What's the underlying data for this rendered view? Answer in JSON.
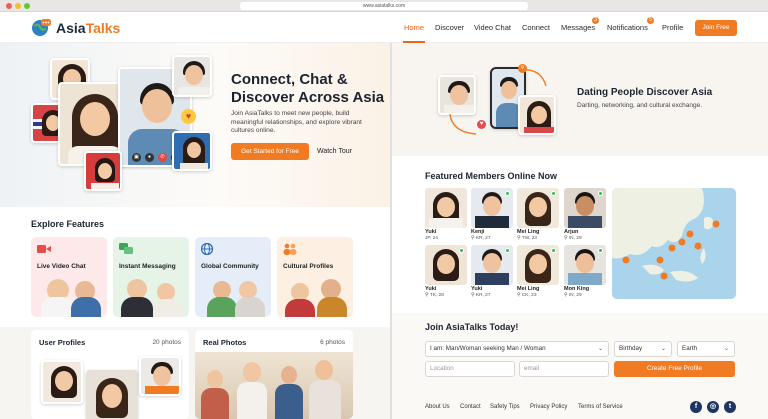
{
  "browser": {
    "url": "www.asiatalks.com"
  },
  "brand": {
    "name_part1": "Asia",
    "name_part2": "Talks",
    "accent": "#f07b22"
  },
  "nav": {
    "links": [
      "Home",
      "Discover",
      "Video Chat",
      "Connect",
      "Messages",
      "Notifications",
      "Profile"
    ],
    "active": "Home",
    "messages_badge": "3",
    "notifications_badge": "5",
    "join_label": "Join Free"
  },
  "hero": {
    "title": "Connect, Chat & Discover Across Asia",
    "subtitle": "Join AsiaTalks to meet new people, build meaningful relationships, and explore vibrant cultures online.",
    "cta_label": "Get Started for Free",
    "tour_label": "Watch Tour"
  },
  "explore": {
    "title": "Explore Features",
    "features": [
      {
        "label": "Live Video Chat",
        "icon": "video-camera-icon"
      },
      {
        "label": "Instant Messaging",
        "icon": "chat-bubbles-icon"
      },
      {
        "label": "Global Community",
        "icon": "globe-icon"
      },
      {
        "label": "Cultural Profiles",
        "icon": "people-icon"
      }
    ]
  },
  "cards": {
    "user_profiles": {
      "title": "User Profiles",
      "count": "20 photos"
    },
    "real_photos": {
      "title": "Real Photos",
      "count": "6 photos"
    }
  },
  "dating": {
    "title": "Dating People Discover Asia",
    "subtitle": "Darting, networking, and cultural exchange."
  },
  "featured": {
    "title": "Featured Members Online Now",
    "members": [
      {
        "name": "Yuki",
        "location": "JP, 24"
      },
      {
        "name": "Kenji",
        "location": "⚲ KR, 27"
      },
      {
        "name": "Mei Ling",
        "location": "⚲ TW, 23"
      },
      {
        "name": "Arjun",
        "location": "⚲ IN, 29"
      },
      {
        "name": "Yuki",
        "location": "⚲ TK, 28"
      },
      {
        "name": "Yuki",
        "location": "⚲ KR, 27"
      },
      {
        "name": "Mei Ling",
        "location": "⚲ CK, 23"
      },
      {
        "name": "Mon King",
        "location": "⚲ IN, 29"
      }
    ]
  },
  "join": {
    "title": "Join AsiaTalks Today!",
    "gender_value": "I am: Man/Woman  seeking Man / Woman",
    "birthday_value": "Birthday",
    "region_value": "Earth",
    "location_placeholder": "Location",
    "email_placeholder": "email",
    "create_label": "Create Free Profile"
  },
  "footer": {
    "links": [
      "About Us",
      "Contact",
      "Safety Tips",
      "Privacy Policy",
      "Terms of Service"
    ],
    "social": [
      {
        "icon": "facebook-icon",
        "glyph": "f"
      },
      {
        "icon": "instagram-icon",
        "glyph": "◎"
      },
      {
        "icon": "twitter-icon",
        "glyph": "t"
      }
    ]
  }
}
